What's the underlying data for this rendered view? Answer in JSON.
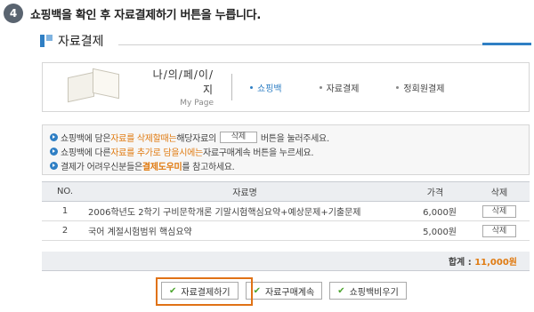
{
  "step": {
    "number": "4",
    "text": "쇼핑백을 확인 후 자료결제하기 버튼을 누릅니다."
  },
  "section": {
    "title": "자료결제",
    "icon": "section-square-icon"
  },
  "mypage": {
    "title_ko": "나/의/페/이/지",
    "title_en": "My Page",
    "icon": "open-book-icon",
    "nav": [
      {
        "label": "쇼핑백",
        "active": true
      },
      {
        "label": "자료결제",
        "active": false
      },
      {
        "label": "정회원결제",
        "active": false
      }
    ]
  },
  "notice": {
    "line1": {
      "p1": "쇼핑백에 담은 ",
      "p2": "자료를 삭제할때는",
      "p3": " 해당자료의 ",
      "btn": "삭제",
      "p4": " 버튼을 눌러주세요."
    },
    "line2": {
      "p1": "쇼핑백에 다른 ",
      "p2": "자료를 추가로 담을시에는",
      "p3": " 자료구매계속 버튼을 누르세요."
    },
    "line3": {
      "p1": "결제가 어려우신분들은 ",
      "p2": "결제도우미",
      "p3": "를 참고하세요."
    }
  },
  "table": {
    "headers": {
      "no": "NO.",
      "name": "자료명",
      "price": "가격",
      "del": "삭제"
    },
    "rows": [
      {
        "no": "1",
        "name": "2006학년도 2학기 구비문학개론 기말시험핵심요약+예상문제+기출문제",
        "price": "6,000원",
        "del": "삭제"
      },
      {
        "no": "2",
        "name": "국어 계절시험범위 핵심요약",
        "price": "5,000원",
        "del": "삭제"
      }
    ],
    "total_label": "합계 : ",
    "total_value": "11,000원"
  },
  "buttons": {
    "pay": "자료결제하기",
    "continue": "자료구매계속",
    "empty": "쇼핑백비우기"
  },
  "colors": {
    "accent": "#2f7fc4",
    "highlight": "#e07216",
    "orange": "#e07b12"
  }
}
